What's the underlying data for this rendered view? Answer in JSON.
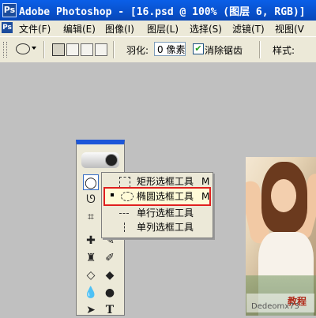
{
  "window": {
    "title": "Adobe Photoshop - [16.psd @ 100% (图层 6, RGB)]",
    "app_badge": "Ps"
  },
  "menu": [
    {
      "label": "文件(F)"
    },
    {
      "label": "编辑(E)"
    },
    {
      "label": "图像(I)"
    },
    {
      "label": "图层(L)"
    },
    {
      "label": "选择(S)"
    },
    {
      "label": "滤镜(T)"
    },
    {
      "label": "视图(V"
    }
  ],
  "options_bar": {
    "feather_label": "羽化:",
    "feather_value": "0 像素",
    "antialias_label": "消除锯齿",
    "antialias_checked": true,
    "style_label": "样式:"
  },
  "flyout": {
    "items": [
      {
        "label": "矩形选框工具",
        "shortcut": "M",
        "icon": "rect-marquee-icon",
        "selected": false
      },
      {
        "label": "椭圆选框工具",
        "shortcut": "M",
        "icon": "elliptical-marquee-icon",
        "selected": true
      },
      {
        "label": "单行选框工具",
        "shortcut": "",
        "icon": "single-row-marquee-icon",
        "selected": false
      },
      {
        "label": "单列选框工具",
        "shortcut": "",
        "icon": "single-column-marquee-icon",
        "selected": false
      }
    ]
  },
  "watermark": {
    "line1": "教程",
    "line2": "Dedeomx73"
  },
  "colors": {
    "titlebar": "#0a5fe8",
    "highlight_border": "#e02020",
    "chrome": "#ece9d8",
    "workspace": "#c0c0c0"
  }
}
